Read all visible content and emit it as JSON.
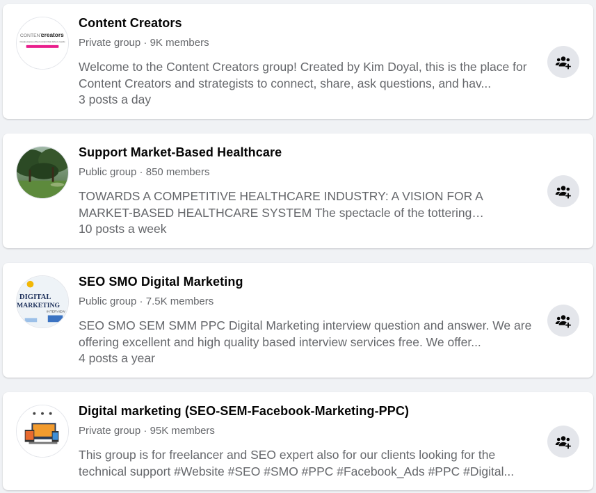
{
  "groups": [
    {
      "name": "Content Creators",
      "privacy": "Private group",
      "members": "9K members",
      "description": "Welcome to the Content Creators group! Created by Kim Doyal, this is the place for Content Creators and strategists to connect, share, ask questions, and hav...",
      "activity": "3 posts a day",
      "avatar": {
        "logo_light": "CONTENT",
        "logo_bold": "creators",
        "tagline": "Create purpose-driven content that delivers results"
      }
    },
    {
      "name": "Support Market-Based Healthcare",
      "privacy": "Public group",
      "members": "850 members",
      "description": "TOWARDS A COMPETITIVE HEALTHCARE INDUSTRY: A VISION FOR A MARKET-BASED HEALTHCARE SYSTEM The spectacle of the tottering Obamacare offers...",
      "activity": "10 posts a week"
    },
    {
      "name": "SEO SMO Digital Marketing",
      "privacy": "Public group",
      "members": "7.5K members",
      "description": "SEO SMO SEM SMM PPC Digital Marketing interview question and answer. We are offering excellent and high quality based interview services free. We offer...",
      "activity": "4 posts a year",
      "avatar": {
        "line1": "DIGITAL",
        "line2": "MARKETING",
        "line3": "INTERVIEW"
      }
    },
    {
      "name": "Digital marketing (SEO-SEM-Facebook-Marketing-PPC)",
      "privacy": "Private group",
      "members": "95K members",
      "description": "This group is for freelancer and SEO expert also for our clients looking for the technical support #Website #SEO #SMO #PPC #Facebook_Ads #PPC #Digital...",
      "activity": ""
    }
  ],
  "separator": " · ",
  "colors": {
    "background": "#f0f2f5",
    "card": "#ffffff",
    "title": "#050505",
    "secondary": "#65676b",
    "button_bg": "#e4e6eb",
    "icon": "#050505"
  },
  "icons": {
    "join": "people-plus-icon"
  }
}
